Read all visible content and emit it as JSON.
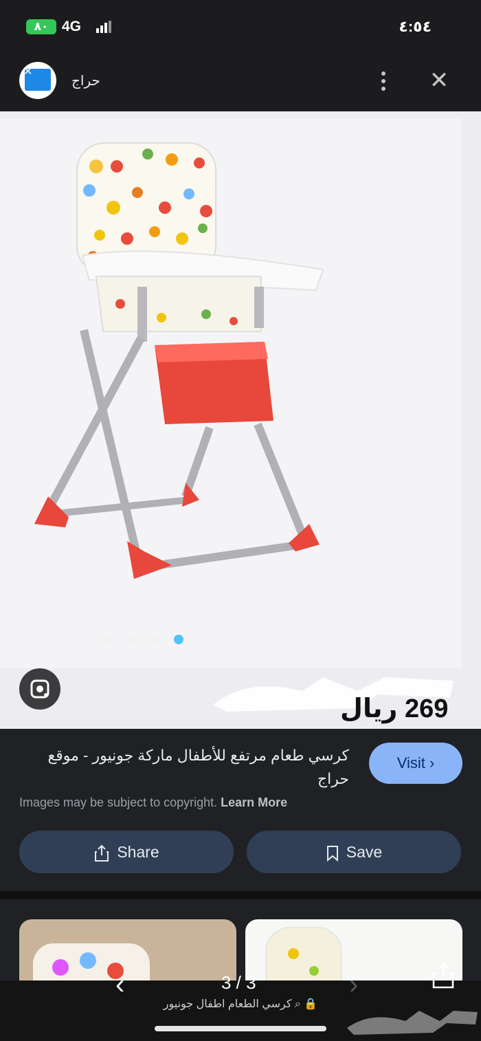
{
  "status_bar": {
    "battery": "٨٠",
    "network": "4G",
    "time": "٤:٥٤"
  },
  "app_bar": {
    "site_name": "حراج",
    "logo_icon": "haraj-logo-icon",
    "menu_icon": "more-vert-icon",
    "close_icon": "close-icon"
  },
  "image": {
    "price_text": "269 ريال",
    "watermark_text": "حراج",
    "carousel": {
      "count": 4,
      "active_index": 3
    },
    "lens_icon": "google-lens-icon"
  },
  "result": {
    "title": "كرسي طعام مرتفع للأطفال ماركة جونيور - موقع حراج",
    "visit_label": "Visit",
    "copyright_text": "Images may be subject to copyright.",
    "learn_more": "Learn More",
    "share_label": "Share",
    "save_label": "Save"
  },
  "browser": {
    "pager": "3 / 3",
    "url_text": "كرسي الطعام اطفال جونيور",
    "watermark_text": "حراج"
  },
  "colors": {
    "accent": "#8ab4f8",
    "pill_bg": "#303f55",
    "dot_active": "#4fc3f7",
    "battery": "#34c759"
  }
}
